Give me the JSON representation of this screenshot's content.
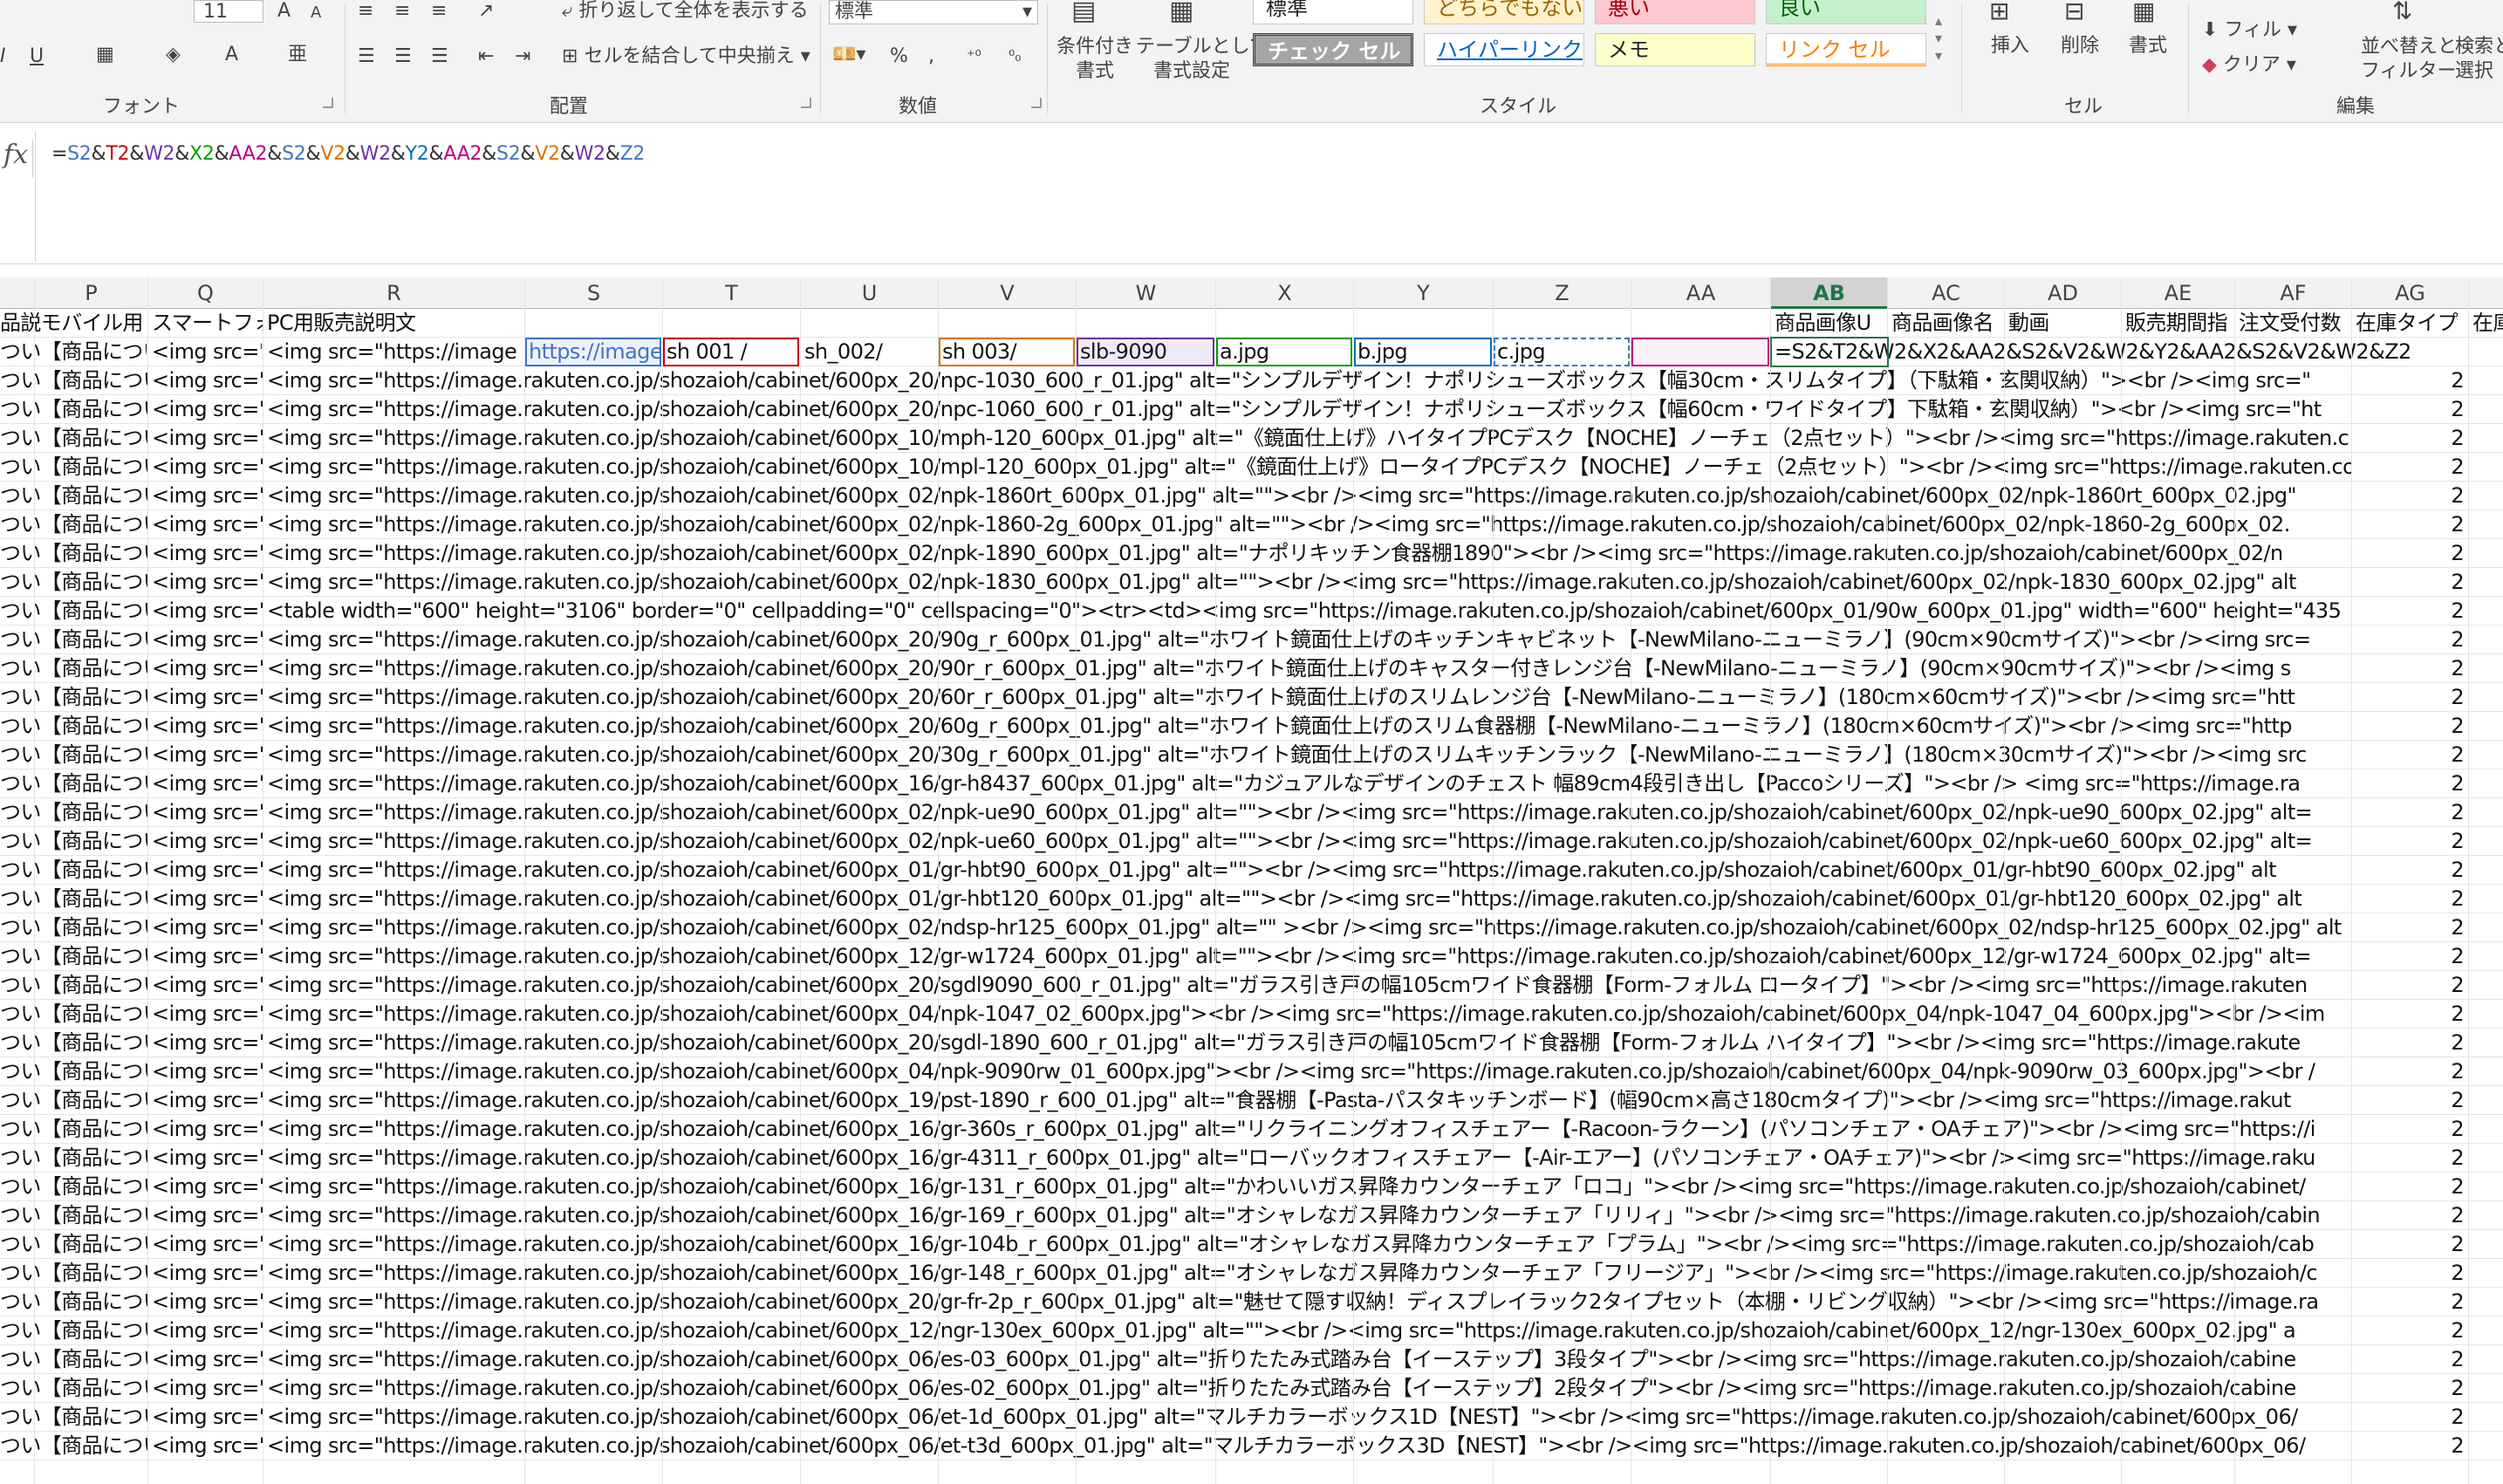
{
  "ribbon": {
    "font_size_value": "11",
    "wrap_text_label": "折り返して全体を表示する",
    "merge_center_label": "セルを結合して中央揃え",
    "number_format_value": "標準",
    "conditional_format_label_1": "条件付き",
    "conditional_format_label_2": "書式",
    "table_format_label_1": "テーブルとして",
    "table_format_label_2": "書式設定",
    "styles": {
      "standard": "標準",
      "neutral": "どちらでもない",
      "bad": "悪い",
      "good": "良い",
      "check_cell": "チェック セル",
      "hyperlink": "ハイパーリンク",
      "memo": "メモ",
      "link_cell": "リンク セル"
    },
    "insert_label": "挿入",
    "delete_label": "削除",
    "format_label": "書式",
    "fill_label": "フィル",
    "clear_label": "クリア",
    "sort_filter_label_1": "並べ替えと",
    "sort_filter_label_2": "フィルター",
    "find_select_label_1": "検索と",
    "find_select_label_2": "選択",
    "group_labels": {
      "font": "フォント",
      "alignment": "配置",
      "number": "数値",
      "styles": "スタイル",
      "cells": "セル",
      "editing": "編集"
    },
    "percent_symbol": "%",
    "comma_symbol": ","
  },
  "formula_bar": {
    "fx_label": "fx",
    "tokens": [
      {
        "text": "=",
        "color": "#333333"
      },
      {
        "text": "S2",
        "color": "#4472c4"
      },
      {
        "text": "&",
        "color": "#333333"
      },
      {
        "text": "T2",
        "color": "#c00000"
      },
      {
        "text": "&",
        "color": "#333333"
      },
      {
        "text": "W2",
        "color": "#7030a0"
      },
      {
        "text": "&",
        "color": "#333333"
      },
      {
        "text": "X2",
        "color": "#00a000"
      },
      {
        "text": "&",
        "color": "#333333"
      },
      {
        "text": "AA2",
        "color": "#c0007a"
      },
      {
        "text": "&",
        "color": "#333333"
      },
      {
        "text": "S2",
        "color": "#4472c4"
      },
      {
        "text": "&",
        "color": "#333333"
      },
      {
        "text": "V2",
        "color": "#e07000"
      },
      {
        "text": "&",
        "color": "#333333"
      },
      {
        "text": "W2",
        "color": "#7030a0"
      },
      {
        "text": "&",
        "color": "#333333"
      },
      {
        "text": "Y2",
        "color": "#0070c0"
      },
      {
        "text": "&",
        "color": "#333333"
      },
      {
        "text": "AA2",
        "color": "#c0007a"
      },
      {
        "text": "&",
        "color": "#333333"
      },
      {
        "text": "S2",
        "color": "#4472c4"
      },
      {
        "text": "&",
        "color": "#333333"
      },
      {
        "text": "V2",
        "color": "#e07000"
      },
      {
        "text": "&",
        "color": "#333333"
      },
      {
        "text": "W2",
        "color": "#7030a0"
      },
      {
        "text": "&",
        "color": "#333333"
      },
      {
        "text": "Z2",
        "color": "#4472c4"
      }
    ]
  },
  "columns": [
    "P",
    "Q",
    "R",
    "S",
    "T",
    "U",
    "V",
    "W",
    "X",
    "Y",
    "Z",
    "AA",
    "AB",
    "AC",
    "AD",
    "AE",
    "AF",
    "AG"
  ],
  "selected_column": "AB",
  "header_row": {
    "P": "品説モバイル用",
    "Q": "スマートフォ",
    "R": "PC用販売説明文",
    "AB": "商品画像U",
    "AC": "商品画像名",
    "AD": "動画",
    "AE": "販売期間指",
    "AF": "注文受付数",
    "AG": "在庫タイプ",
    "AH": "在庫"
  },
  "row2": {
    "P": "つい【商品につい",
    "Q": "<img src=\"",
    "R": "<img src=\"https://image",
    "S": "https://image",
    "T": "sh 001 /",
    "U": "sh_002/",
    "V": "sh 003/",
    "W": "slb-9090",
    "X": "a.jpg",
    "Y": "b.jpg",
    "Z": "c.jpg",
    "AB": "=S2&T2&W2&X2&AA2&S2&V2&W2&Y2&AA2&S2&V2&W2&Z2"
  },
  "row_prefix_p": "つい【商品につい",
  "row_prefix_q": "<img src=\"",
  "stock_value": "2",
  "data_rows": [
    "<img src=\"https://image.rakuten.co.jp/shozaioh/cabinet/600px_20/npc-1030_600_r_01.jpg\" alt=\"シンプルデザイン！ナポリシューズボックス【幅30cm・スリムタイプ】（下駄箱・玄関収納）\"><br /><img src=\"",
    "<img src=\"https://image.rakuten.co.jp/shozaioh/cabinet/600px_20/npc-1060_600_r_01.jpg\" alt=\"シンプルデザイン！ナポリシューズボックス【幅60cm・ワイドタイプ】下駄箱・玄関収納）\"><br /><img src=\"ht",
    "<img src=\"https://image.rakuten.co.jp/shozaioh/cabinet/600px_10/mph-120_600px_01.jpg\" alt=\"《鏡面仕上げ》ハイタイプPCデスク【NOCHE】ノーチェ（2点セット）\"><br /><img src=\"https://image.rakuten.c",
    "<img src=\"https://image.rakuten.co.jp/shozaioh/cabinet/600px_10/mpl-120_600px_01.jpg\" alt=\"《鏡面仕上げ》ロータイプPCデスク【NOCHE】ノーチェ（2点セット）\"><br /><img src=\"https://image.rakuten.co",
    "<img src=\"https://image.rakuten.co.jp/shozaioh/cabinet/600px_02/npk-1860rt_600px_01.jpg\" alt=\"\"><br /><img src=\"https://image.rakuten.co.jp/shozaioh/cabinet/600px_02/npk-1860rt_600px_02.jpg\"",
    "<img src=\"https://image.rakuten.co.jp/shozaioh/cabinet/600px_02/npk-1860-2g_600px_01.jpg\" alt=\"\"><br /><img src=\"https://image.rakuten.co.jp/shozaioh/cabinet/600px_02/npk-1860-2g_600px_02.",
    "<img src=\"https://image.rakuten.co.jp/shozaioh/cabinet/600px_02/npk-1890_600px_01.jpg\" alt=\"ナポリキッチン食器棚1890\"><br /><img src=\"https://image.rakuten.co.jp/shozaioh/cabinet/600px_02/n",
    "<img src=\"https://image.rakuten.co.jp/shozaioh/cabinet/600px_02/npk-1830_600px_01.jpg\" alt=\"\"><br /><img src=\"https://image.rakuten.co.jp/shozaioh/cabinet/600px_02/npk-1830_600px_02.jpg\" alt",
    "<table width=\"600\" height=\"3106\" border=\"0\" cellpadding=\"0\" cellspacing=\"0\"><tr><td><img src=\"https://image.rakuten.co.jp/shozaioh/cabinet/600px_01/90w_600px_01.jpg\" width=\"600\" height=\"435",
    "<img src=\"https://image.rakuten.co.jp/shozaioh/cabinet/600px_20/90g_r_600px_01.jpg\" alt=\"ホワイト鏡面仕上げのキッチンキャビネット【-NewMilano-ニューミラノ】(90cm×90cmサイズ)\"><br /><img src=",
    "<img src=\"https://image.rakuten.co.jp/shozaioh/cabinet/600px_20/90r_r_600px_01.jpg\" alt=\"ホワイト鏡面仕上げのキャスター付きレンジ台【-NewMilano-ニューミラノ】(90cm×90cmサイズ)\"><br /><img s",
    "<img src=\"https://image.rakuten.co.jp/shozaioh/cabinet/600px_20/60r_r_600px_01.jpg\" alt=\"ホワイト鏡面仕上げのスリムレンジ台【-NewMilano-ニューミラノ】(180cm×60cmサイズ)\"><br /><img src=\"htt",
    "<img src=\"https://image.rakuten.co.jp/shozaioh/cabinet/600px_20/60g_r_600px_01.jpg\" alt=\"ホワイト鏡面仕上げのスリム食器棚【-NewMilano-ニューミラノ】(180cm×60cmサイズ)\"><br /><img src=\"http",
    "<img src=\"https://image.rakuten.co.jp/shozaioh/cabinet/600px_20/30g_r_600px_01.jpg\" alt=\"ホワイト鏡面仕上げのスリムキッチンラック【-NewMilano-ニューミラノ】(180cm×30cmサイズ)\"><br /><img src",
    "<img src=\"https://image.rakuten.co.jp/shozaioh/cabinet/600px_16/gr-h8437_600px_01.jpg\" alt=\"カジュアルなデザインのチェスト 幅89cm4段引き出し【Paccoシリーズ】\"><br /> <img src=\"https://image.ra",
    "<img src=\"https://image.rakuten.co.jp/shozaioh/cabinet/600px_02/npk-ue90_600px_01.jpg\" alt=\"\"><br /><img src=\"https://image.rakuten.co.jp/shozaioh/cabinet/600px_02/npk-ue90_600px_02.jpg\" alt=",
    "<img src=\"https://image.rakuten.co.jp/shozaioh/cabinet/600px_02/npk-ue60_600px_01.jpg\" alt=\"\"><br /><img src=\"https://image.rakuten.co.jp/shozaioh/cabinet/600px_02/npk-ue60_600px_02.jpg\" alt=",
    "<img src=\"https://image.rakuten.co.jp/shozaioh/cabinet/600px_01/gr-hbt90_600px_01.jpg\" alt=\"\"><br /><img src=\"https://image.rakuten.co.jp/shozaioh/cabinet/600px_01/gr-hbt90_600px_02.jpg\" alt",
    "<img src=\"https://image.rakuten.co.jp/shozaioh/cabinet/600px_01/gr-hbt120_600px_01.jpg\" alt=\"\"><br /><img src=\"https://image.rakuten.co.jp/shozaioh/cabinet/600px_01/gr-hbt120_600px_02.jpg\" alt",
    "<img src=\"https://image.rakuten.co.jp/shozaioh/cabinet/600px_02/ndsp-hr125_600px_01.jpg\" alt=\"\" ><br /><img src=\"https://image.rakuten.co.jp/shozaioh/cabinet/600px_02/ndsp-hr125_600px_02.jpg\" alt",
    "<img src=\"https://image.rakuten.co.jp/shozaioh/cabinet/600px_12/gr-w1724_600px_01.jpg\" alt=\"\"><br /><img src=\"https://image.rakuten.co.jp/shozaioh/cabinet/600px_12/gr-w1724_600px_02.jpg\" alt=",
    "<img src=\"https://image.rakuten.co.jp/shozaioh/cabinet/600px_20/sgdl9090_600_r_01.jpg\" alt=\"ガラス引き戸の幅105cmワイド食器棚【Form-フォルム ロータイプ】\"><br /><img src=\"https://image.rakuten",
    "<img src=\"https://image.rakuten.co.jp/shozaioh/cabinet/600px_04/npk-1047_02_600px.jpg\"><br /><img src=\"https://image.rakuten.co.jp/shozaioh/cabinet/600px_04/npk-1047_04_600px.jpg\"><br /><im",
    "<img src=\"https://image.rakuten.co.jp/shozaioh/cabinet/600px_20/sgdl-1890_600_r_01.jpg\" alt=\"ガラス引き戸の幅105cmワイド食器棚【Form-フォルム ハイタイプ】\"><br /><img src=\"https://image.rakute",
    "<img src=\"https://image.rakuten.co.jp/shozaioh/cabinet/600px_04/npk-9090rw_01_600px.jpg\"><br /><img src=\"https://image.rakuten.co.jp/shozaioh/cabinet/600px_04/npk-9090rw_03_600px.jpg\"><br /",
    "<img src=\"https://image.rakuten.co.jp/shozaioh/cabinet/600px_19/pst-1890_r_600_01.jpg\" alt=\"食器棚【-Pasta-パスタキッチンボード】(幅90cm×高さ180cmタイプ)\"><br /><img src=\"https://image.rakut",
    "<img src=\"https://image.rakuten.co.jp/shozaioh/cabinet/600px_16/gr-360s_r_600px_01.jpg\" alt=\"リクライニングオフィスチェアー【-Racoon-ラクーン】(パソコンチェア・OAチェア)\"><br /><img src=\"https://i",
    "<img src=\"https://image.rakuten.co.jp/shozaioh/cabinet/600px_16/gr-4311_r_600px_01.jpg\" alt=\"ローバックオフィスチェアー【-Air-エアー】(パソコンチェア・OAチェア)\"><br /><img src=\"https://image.raku",
    "<img src=\"https://image.rakuten.co.jp/shozaioh/cabinet/600px_16/gr-131_r_600px_01.jpg\" alt=\"かわいいガス昇降カウンターチェア「ロコ」\"><br /><img src=\"https://image.rakuten.co.jp/shozaioh/cabinet/",
    "<img src=\"https://image.rakuten.co.jp/shozaioh/cabinet/600px_16/gr-169_r_600px_01.jpg\" alt=\"オシャレなガス昇降カウンターチェア「リリィ」\"><br /><img src=\"https://image.rakuten.co.jp/shozaioh/cabin",
    "<img src=\"https://image.rakuten.co.jp/shozaioh/cabinet/600px_16/gr-104b_r_600px_01.jpg\" alt=\"オシャレなガス昇降カウンターチェア「プラム」\"><br /><img src=\"https://image.rakuten.co.jp/shozaioh/cab",
    "<img src=\"https://image.rakuten.co.jp/shozaioh/cabinet/600px_16/gr-148_r_600px_01.jpg\" alt=\"オシャレなガス昇降カウンターチェア「フリージア」\"><br /><img src=\"https://image.rakuten.co.jp/shozaioh/c",
    "<img src=\"https://image.rakuten.co.jp/shozaioh/cabinet/600px_20/gr-fr-2p_r_600px_01.jpg\" alt=\"魅せて隠す収納！ディスプレイラック2タイプセット（本棚・リビング収納）\"><br /><img src=\"https://image.ra",
    "<img src=\"https://image.rakuten.co.jp/shozaioh/cabinet/600px_12/ngr-130ex_600px_01.jpg\" alt=\"\"><br /><img src=\"https://image.rakuten.co.jp/shozaioh/cabinet/600px_12/ngr-130ex_600px_02.jpg\" a",
    "<img src=\"https://image.rakuten.co.jp/shozaioh/cabinet/600px_06/es-03_600px_01.jpg\" alt=\"折りたたみ式踏み台【イーステップ】3段タイプ\"><br /><img src=\"https://image.rakuten.co.jp/shozaioh/cabine",
    "<img src=\"https://image.rakuten.co.jp/shozaioh/cabinet/600px_06/es-02_600px_01.jpg\" alt=\"折りたたみ式踏み台【イーステップ】2段タイプ\"><br /><img src=\"https://image.rakuten.co.jp/shozaioh/cabine",
    "<img src=\"https://image.rakuten.co.jp/shozaioh/cabinet/600px_06/et-1d_600px_01.jpg\" alt=\"マルチカラーボックス1D【NEST】\"><br /><img src=\"https://image.rakuten.co.jp/shozaioh/cabinet/600px_06/",
    "<img src=\"https://image.rakuten.co.jp/shozaioh/cabinet/600px_06/et-t3d_600px_01.jpg\" alt=\"マルチカラーボックス3D【NEST】\"><br /><img src=\"https://image.rakuten.co.jp/shozaioh/cabinet/600px_06/"
  ]
}
